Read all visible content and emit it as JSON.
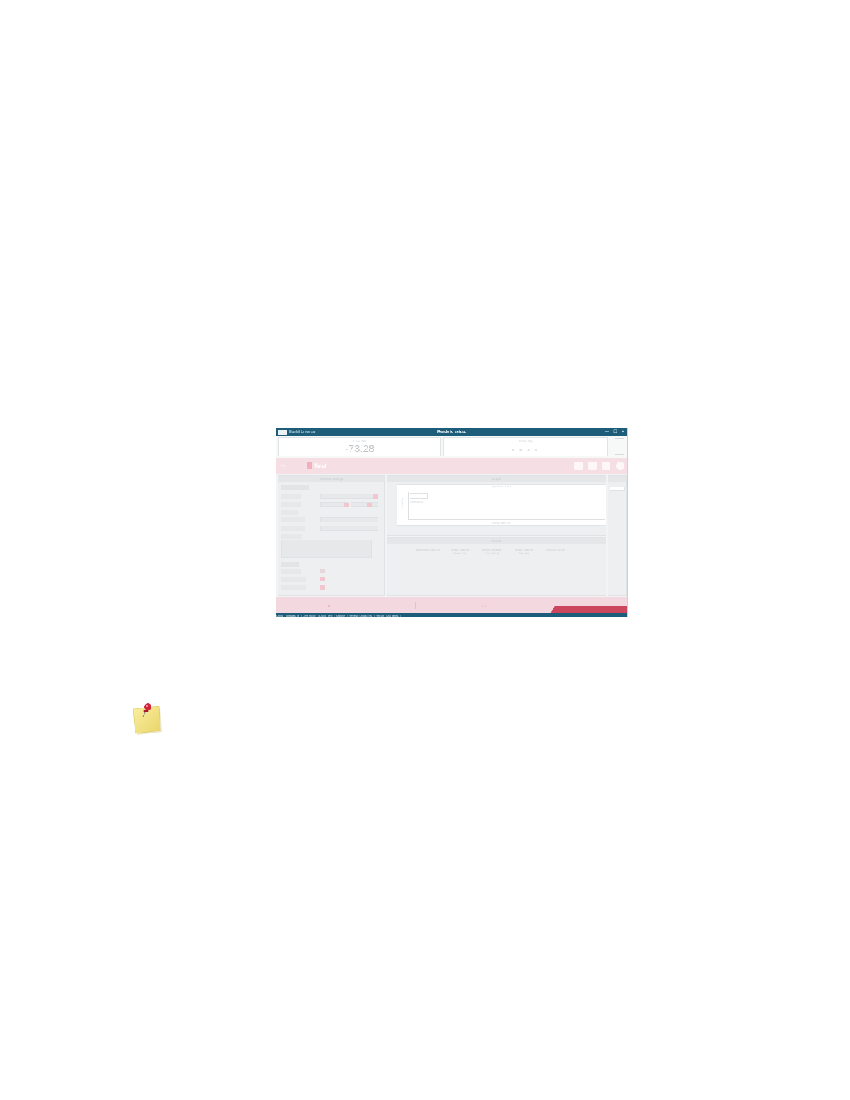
{
  "app": {
    "name": "Bluehill Universal",
    "status": "Ready to setup.",
    "window_controls": [
      "—",
      "☐",
      "✕"
    ]
  },
  "readouts": [
    {
      "label": "Load (N)",
      "value": "-73.28"
    },
    {
      "label": "Strain (%)",
      "value": "- - - -"
    }
  ],
  "nav": {
    "active_tab": "Test"
  },
  "panels": {
    "left_title": "Test/Run settings",
    "graph_title": "Graph",
    "results_title": "Results"
  },
  "graph": {
    "title": "Specimen 1 to 1",
    "legend": "Specimen 1",
    "xlabel": "Tensile strain (%)",
    "ylabel": "Load (N)"
  },
  "results_columns": [
    "Maximum Load (N)",
    "Tensile strain at Break (%)",
    "Tensile stress at Yield (MPa)",
    "Tensile strain at Yield (%)",
    "Modulus (MPa)"
  ],
  "bottom": {
    "play_label": "▶",
    "counter": "1 / 1"
  },
  "statusbar": [
    "Units",
    "Results off",
    "Live mode",
    "Quick Test",
    "Sample",
    "Refresh Quick Test",
    "Report",
    "All items"
  ],
  "colors": {
    "rule": "#b43a52",
    "titlebar": "#1d5d7a",
    "accent_red": "#c8364f",
    "note_yellow": "#f4e27a",
    "pin_red": "#d1243d"
  },
  "icons": [
    "home-icon",
    "test-icon",
    "flag-icon",
    "report-icon",
    "thumbs-up-icon",
    "help-icon",
    "pushpin-note-icon"
  ]
}
